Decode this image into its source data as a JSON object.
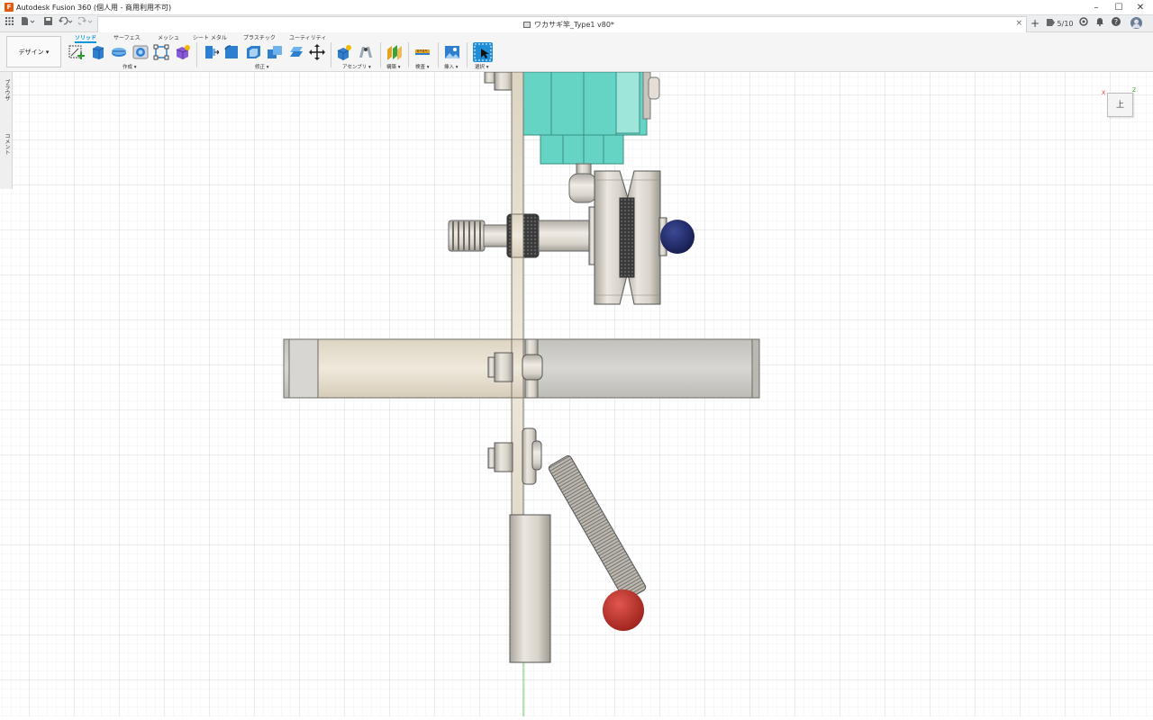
{
  "window": {
    "title": "Autodesk Fusion 360 (個人用 - 商用利用不可)",
    "controls": [
      "–",
      "☐",
      "✕"
    ]
  },
  "quick_access": {
    "grid_icon": "grid-icon",
    "file_icon": "file-icon",
    "save_icon": "save-icon",
    "undo_icon": "undo-icon",
    "redo_icon": "redo-icon"
  },
  "document_tab": {
    "title": "ワカサギ竿_Type1 v80*",
    "close": "×"
  },
  "top_right": {
    "add": "+",
    "jobs": "5/10"
  },
  "workspace": {
    "label": "デザイン ▾"
  },
  "toolbar_tabs": [
    "ソリッド",
    "サーフェス",
    "メッシュ",
    "シート メタル",
    "プラスチック",
    "ユーティリティ"
  ],
  "toolbar_groups": [
    "作成 ▾",
    "修正 ▾",
    "アセンブリ ▾",
    "構築 ▾",
    "検査 ▾",
    "挿入 ▾",
    "選択 ▾"
  ],
  "left_panel": {
    "browser": "ブラウザ",
    "comments": "コメント"
  },
  "view_cube": {
    "face": "上",
    "x": "X",
    "z": "Z"
  },
  "colors": {
    "accent": "#0696d7",
    "teal_part": "#66d4c4",
    "red_ball": "#c8302c",
    "blue_ball": "#1f2a6b"
  }
}
